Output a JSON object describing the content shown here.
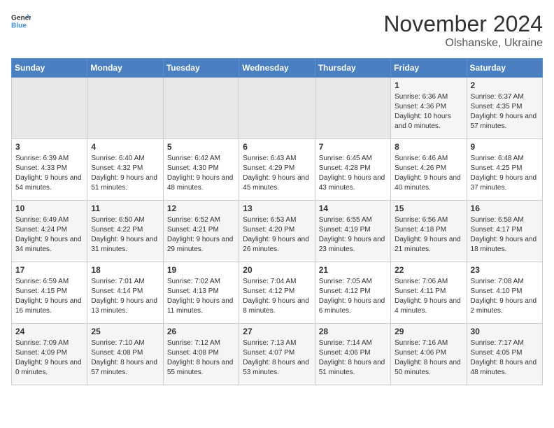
{
  "header": {
    "logo_line1": "General",
    "logo_line2": "Blue",
    "month": "November 2024",
    "location": "Olshanske, Ukraine"
  },
  "days_of_week": [
    "Sunday",
    "Monday",
    "Tuesday",
    "Wednesday",
    "Thursday",
    "Friday",
    "Saturday"
  ],
  "weeks": [
    [
      {
        "day": "",
        "content": ""
      },
      {
        "day": "",
        "content": ""
      },
      {
        "day": "",
        "content": ""
      },
      {
        "day": "",
        "content": ""
      },
      {
        "day": "",
        "content": ""
      },
      {
        "day": "1",
        "content": "Sunrise: 6:36 AM\nSunset: 4:36 PM\nDaylight: 10 hours and 0 minutes."
      },
      {
        "day": "2",
        "content": "Sunrise: 6:37 AM\nSunset: 4:35 PM\nDaylight: 9 hours and 57 minutes."
      }
    ],
    [
      {
        "day": "3",
        "content": "Sunrise: 6:39 AM\nSunset: 4:33 PM\nDaylight: 9 hours and 54 minutes."
      },
      {
        "day": "4",
        "content": "Sunrise: 6:40 AM\nSunset: 4:32 PM\nDaylight: 9 hours and 51 minutes."
      },
      {
        "day": "5",
        "content": "Sunrise: 6:42 AM\nSunset: 4:30 PM\nDaylight: 9 hours and 48 minutes."
      },
      {
        "day": "6",
        "content": "Sunrise: 6:43 AM\nSunset: 4:29 PM\nDaylight: 9 hours and 45 minutes."
      },
      {
        "day": "7",
        "content": "Sunrise: 6:45 AM\nSunset: 4:28 PM\nDaylight: 9 hours and 43 minutes."
      },
      {
        "day": "8",
        "content": "Sunrise: 6:46 AM\nSunset: 4:26 PM\nDaylight: 9 hours and 40 minutes."
      },
      {
        "day": "9",
        "content": "Sunrise: 6:48 AM\nSunset: 4:25 PM\nDaylight: 9 hours and 37 minutes."
      }
    ],
    [
      {
        "day": "10",
        "content": "Sunrise: 6:49 AM\nSunset: 4:24 PM\nDaylight: 9 hours and 34 minutes."
      },
      {
        "day": "11",
        "content": "Sunrise: 6:50 AM\nSunset: 4:22 PM\nDaylight: 9 hours and 31 minutes."
      },
      {
        "day": "12",
        "content": "Sunrise: 6:52 AM\nSunset: 4:21 PM\nDaylight: 9 hours and 29 minutes."
      },
      {
        "day": "13",
        "content": "Sunrise: 6:53 AM\nSunset: 4:20 PM\nDaylight: 9 hours and 26 minutes."
      },
      {
        "day": "14",
        "content": "Sunrise: 6:55 AM\nSunset: 4:19 PM\nDaylight: 9 hours and 23 minutes."
      },
      {
        "day": "15",
        "content": "Sunrise: 6:56 AM\nSunset: 4:18 PM\nDaylight: 9 hours and 21 minutes."
      },
      {
        "day": "16",
        "content": "Sunrise: 6:58 AM\nSunset: 4:17 PM\nDaylight: 9 hours and 18 minutes."
      }
    ],
    [
      {
        "day": "17",
        "content": "Sunrise: 6:59 AM\nSunset: 4:15 PM\nDaylight: 9 hours and 16 minutes."
      },
      {
        "day": "18",
        "content": "Sunrise: 7:01 AM\nSunset: 4:14 PM\nDaylight: 9 hours and 13 minutes."
      },
      {
        "day": "19",
        "content": "Sunrise: 7:02 AM\nSunset: 4:13 PM\nDaylight: 9 hours and 11 minutes."
      },
      {
        "day": "20",
        "content": "Sunrise: 7:04 AM\nSunset: 4:12 PM\nDaylight: 9 hours and 8 minutes."
      },
      {
        "day": "21",
        "content": "Sunrise: 7:05 AM\nSunset: 4:12 PM\nDaylight: 9 hours and 6 minutes."
      },
      {
        "day": "22",
        "content": "Sunrise: 7:06 AM\nSunset: 4:11 PM\nDaylight: 9 hours and 4 minutes."
      },
      {
        "day": "23",
        "content": "Sunrise: 7:08 AM\nSunset: 4:10 PM\nDaylight: 9 hours and 2 minutes."
      }
    ],
    [
      {
        "day": "24",
        "content": "Sunrise: 7:09 AM\nSunset: 4:09 PM\nDaylight: 9 hours and 0 minutes."
      },
      {
        "day": "25",
        "content": "Sunrise: 7:10 AM\nSunset: 4:08 PM\nDaylight: 8 hours and 57 minutes."
      },
      {
        "day": "26",
        "content": "Sunrise: 7:12 AM\nSunset: 4:08 PM\nDaylight: 8 hours and 55 minutes."
      },
      {
        "day": "27",
        "content": "Sunrise: 7:13 AM\nSunset: 4:07 PM\nDaylight: 8 hours and 53 minutes."
      },
      {
        "day": "28",
        "content": "Sunrise: 7:14 AM\nSunset: 4:06 PM\nDaylight: 8 hours and 51 minutes."
      },
      {
        "day": "29",
        "content": "Sunrise: 7:16 AM\nSunset: 4:06 PM\nDaylight: 8 hours and 50 minutes."
      },
      {
        "day": "30",
        "content": "Sunrise: 7:17 AM\nSunset: 4:05 PM\nDaylight: 8 hours and 48 minutes."
      }
    ]
  ]
}
